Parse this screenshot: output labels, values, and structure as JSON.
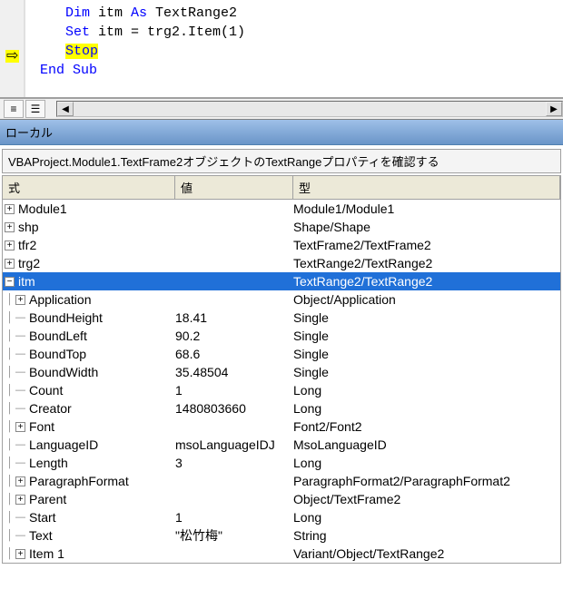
{
  "code": {
    "line1_pre": "Dim",
    "line1_mid": " itm ",
    "line1_as": "As",
    "line1_post": " TextRange2",
    "line2_pre": "Set",
    "line2_post": " itm = trg2.Item(1)",
    "line3": "Stop",
    "line4": "End Sub"
  },
  "locals": {
    "panel_title": "ローカル",
    "context": "VBAProject.Module1.TextFrame2オブジェクトのTextRangeプロパティを確認する",
    "columns": {
      "expr": "式",
      "value": "値",
      "type": "型"
    },
    "rows": [
      {
        "depth": 0,
        "toggle": "plus",
        "name": "Module1",
        "value": "",
        "type": "Module1/Module1",
        "selected": false
      },
      {
        "depth": 0,
        "toggle": "plus",
        "name": "shp",
        "value": "",
        "type": "Shape/Shape",
        "selected": false
      },
      {
        "depth": 0,
        "toggle": "plus",
        "name": "tfr2",
        "value": "",
        "type": "TextFrame2/TextFrame2",
        "selected": false
      },
      {
        "depth": 0,
        "toggle": "plus",
        "name": "trg2",
        "value": "",
        "type": "TextRange2/TextRange2",
        "selected": false
      },
      {
        "depth": 0,
        "toggle": "minus",
        "name": "itm",
        "value": "",
        "type": "TextRange2/TextRange2",
        "selected": true
      },
      {
        "depth": 1,
        "toggle": "plus",
        "name": "Application",
        "value": "",
        "type": "Object/Application",
        "selected": false
      },
      {
        "depth": 1,
        "toggle": "leaf",
        "name": "BoundHeight",
        "value": "18.41",
        "type": "Single",
        "selected": false
      },
      {
        "depth": 1,
        "toggle": "leaf",
        "name": "BoundLeft",
        "value": "90.2",
        "type": "Single",
        "selected": false
      },
      {
        "depth": 1,
        "toggle": "leaf",
        "name": "BoundTop",
        "value": "68.6",
        "type": "Single",
        "selected": false
      },
      {
        "depth": 1,
        "toggle": "leaf",
        "name": "BoundWidth",
        "value": "35.48504",
        "type": "Single",
        "selected": false
      },
      {
        "depth": 1,
        "toggle": "leaf",
        "name": "Count",
        "value": "1",
        "type": "Long",
        "selected": false
      },
      {
        "depth": 1,
        "toggle": "leaf",
        "name": "Creator",
        "value": "1480803660",
        "type": "Long",
        "selected": false
      },
      {
        "depth": 1,
        "toggle": "plus",
        "name": "Font",
        "value": "",
        "type": "Font2/Font2",
        "selected": false
      },
      {
        "depth": 1,
        "toggle": "leaf",
        "name": "LanguageID",
        "value": "msoLanguageIDJ",
        "type": "MsoLanguageID",
        "selected": false
      },
      {
        "depth": 1,
        "toggle": "leaf",
        "name": "Length",
        "value": "3",
        "type": "Long",
        "selected": false
      },
      {
        "depth": 1,
        "toggle": "plus",
        "name": "ParagraphFormat",
        "value": "",
        "type": "ParagraphFormat2/ParagraphFormat2",
        "selected": false
      },
      {
        "depth": 1,
        "toggle": "plus",
        "name": "Parent",
        "value": "",
        "type": "Object/TextFrame2",
        "selected": false
      },
      {
        "depth": 1,
        "toggle": "leaf",
        "name": "Start",
        "value": "1",
        "type": "Long",
        "selected": false
      },
      {
        "depth": 1,
        "toggle": "leaf",
        "name": "Text",
        "value": "\"松竹梅\"",
        "type": "String",
        "selected": false
      },
      {
        "depth": 1,
        "toggle": "plus",
        "name": "Item 1",
        "value": "",
        "type": "Variant/Object/TextRange2",
        "selected": false
      }
    ]
  },
  "glyph": {
    "plus": "+",
    "minus": "−",
    "leaf": "—",
    "line": "│"
  }
}
